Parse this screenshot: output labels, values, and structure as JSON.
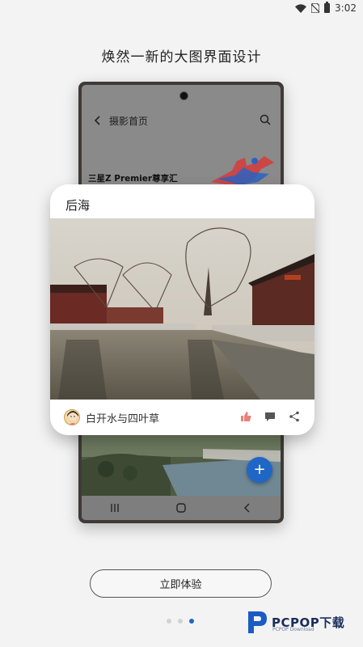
{
  "status_bar": {
    "time": "3:02"
  },
  "page_title": "焕然一新的大图界面设计",
  "phone": {
    "header_title": "摄影首页",
    "banner_text": "三星Z Premier尊享汇"
  },
  "card": {
    "location_title": "后海",
    "author": "白开水与四叶草"
  },
  "cta_label": "立即体验",
  "pager": {
    "total": 3,
    "active_index": 2
  },
  "watermark": {
    "brand": "PCPOP下载",
    "sub": "PCPOP Download"
  },
  "colors": {
    "accent": "#1f66c6",
    "like": "#e9827a"
  },
  "icons": [
    "wifi-icon",
    "no-sim-icon",
    "battery-icon",
    "back-arrow-icon",
    "search-icon",
    "plus-icon",
    "like-icon",
    "comment-icon",
    "share-icon"
  ]
}
